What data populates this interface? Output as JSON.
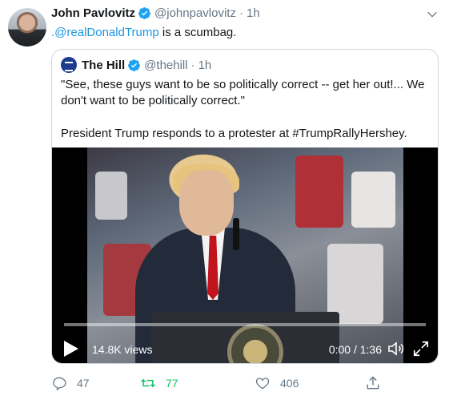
{
  "tweet": {
    "author_name": "John Pavlovitz",
    "handle": "@johnpavlovitz",
    "separator": "·",
    "time": "1h",
    "mention": ".@realDonaldTrump",
    "text_rest": " is a scumbag."
  },
  "quote": {
    "author_name": "The Hill",
    "handle": "@thehill",
    "separator": "·",
    "time": "1h",
    "paragraph_1": "\"See, these guys want to be so politically correct -- get her out!... We don't want to be politically correct.\"",
    "paragraph_2": "President Trump responds to a protester at #TrumpRallyHershey."
  },
  "video": {
    "views": "14.8K views",
    "time_display": "0:00 / 1:36",
    "progress": 0.0
  },
  "actions": {
    "replies": "47",
    "retweets": "77",
    "likes": "406"
  },
  "colors": {
    "verified": "#1da1f2",
    "link": "#1b95e0",
    "retweet_active": "#17bf63",
    "muted": "#657786"
  },
  "icons": [
    "verified-badge-icon",
    "chevron-down-icon",
    "play-icon",
    "volume-icon",
    "expand-icon",
    "reply-icon",
    "retweet-icon",
    "like-icon",
    "share-icon"
  ]
}
